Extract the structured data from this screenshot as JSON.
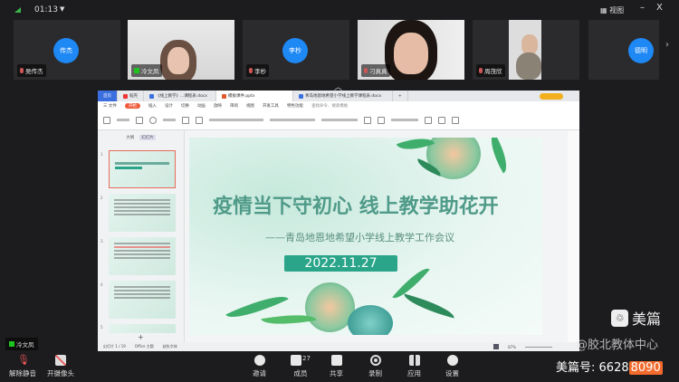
{
  "topbar": {
    "duration": "01:13",
    "view_label": "视图",
    "minimize": "–",
    "close": "X"
  },
  "participants": [
    {
      "name": "吴传杰",
      "avatar_text": "传杰"
    },
    {
      "name": "冷文凤"
    },
    {
      "name": "李杪",
      "avatar_text": "李杪"
    },
    {
      "name": "刁真真"
    },
    {
      "name": "周茂欣"
    },
    {
      "avatar_text": "德明"
    }
  ],
  "wps": {
    "tabs": [
      "首页",
      "稻壳",
      "《线上教学》...课程表.docx",
      "模板课件.pptx",
      "青岛地恩地希望小学线上教学课程表.docx",
      "+"
    ],
    "menu": [
      "三 文件",
      "开始",
      "插入",
      "设计",
      "切换",
      "动画",
      "放映",
      "审阅",
      "视图",
      "开发工具",
      "特色功能",
      "查找命令、搜索模板"
    ],
    "panel_tabs": [
      "大纲",
      "幻灯片"
    ],
    "status": [
      "幻灯片 1 / 19",
      "Office 主题",
      "缺失字体"
    ],
    "zoom": "87%"
  },
  "slide": {
    "title": "疫情当下守初心 线上教学助花开",
    "subtitle": "——青岛地恩地希望小学线上教学工作会议",
    "date": "2022.11.27"
  },
  "self_label": "冷文凤",
  "toolbar": {
    "unmute": "解除静音",
    "camera": "开摄像头",
    "invite": "邀请",
    "members": "成员",
    "member_count": "27",
    "share": "共享",
    "record": "录制",
    "apps": "应用",
    "settings": "设置"
  },
  "watermark": {
    "brand": "美篇",
    "account": "@胶北教体中心",
    "id_label": "美篇号:",
    "id_value": "6628",
    "id_highlight": "8090"
  }
}
